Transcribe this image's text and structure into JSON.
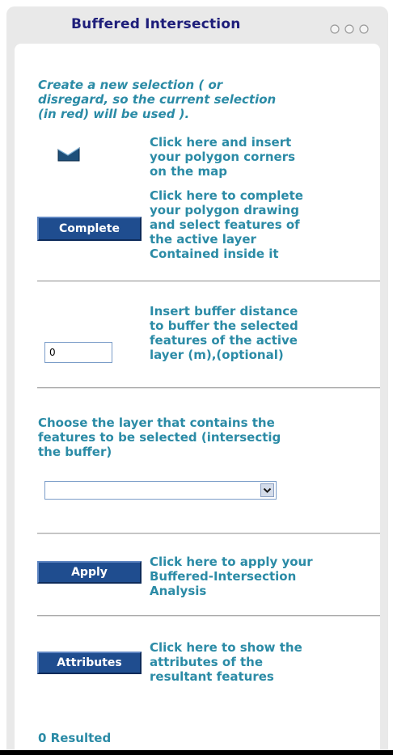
{
  "panel": {
    "title": "Buffered Intersection"
  },
  "selection": {
    "instruction_lines": [
      "Create a new selection ( or",
      "disregard, so the current selection",
      "(in red) will be used )."
    ],
    "draw_tool_icon": "draw-polygon-icon",
    "draw_hint_lines": [
      "Click here and insert",
      "your polygon corners",
      "on the map"
    ],
    "complete_label": "Complete",
    "complete_hint_lines": [
      "Click here to complete",
      "your polygon drawing",
      "and select features of",
      "the active layer",
      "Contained inside it"
    ]
  },
  "buffer": {
    "value": "0",
    "hint_lines": [
      "Insert buffer distance",
      "to buffer the selected",
      "features of the active",
      "layer (m),(optional)"
    ]
  },
  "layer": {
    "instruction_lines": [
      "Choose the layer that contains the",
      "features to be selected (intersectig",
      "the buffer)"
    ],
    "selected_value": "",
    "arrow_icon": "chevron-down-icon"
  },
  "apply": {
    "label": "Apply",
    "hint_lines": [
      "Click here to apply your",
      "Buffered-Intersection",
      "Analysis"
    ]
  },
  "attributes": {
    "label": "Attributes",
    "hint_lines": [
      "Click here to show the",
      "attributes of the",
      "resultant features"
    ]
  },
  "result": {
    "text": "0 Resulted"
  },
  "colors": {
    "title": "#1e1e7a",
    "text_teal": "#2b8ba6",
    "button_blue": "#1f4d8f",
    "panel_gray": "#e9e9e9"
  }
}
